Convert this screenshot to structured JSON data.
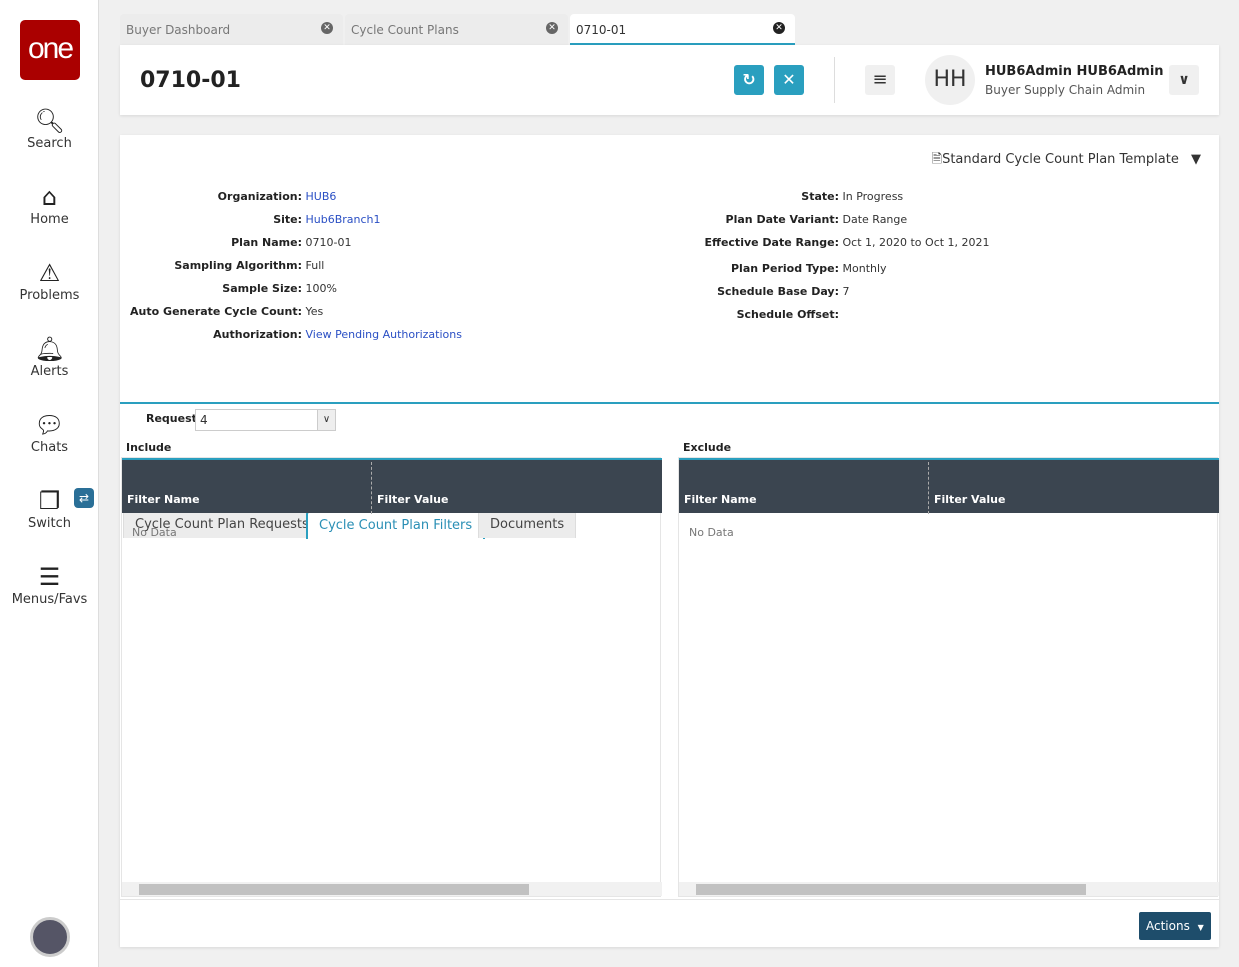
{
  "sidebar": {
    "logo": "one",
    "items": [
      {
        "label": "Search",
        "icon": "search-icon"
      },
      {
        "label": "Home",
        "icon": "home-icon"
      },
      {
        "label": "Problems",
        "icon": "warning-icon"
      },
      {
        "label": "Alerts",
        "icon": "bell-icon"
      },
      {
        "label": "Chats",
        "icon": "chat-icon"
      },
      {
        "label": "Switch",
        "icon": "switch-icon"
      },
      {
        "label": "Menus/Favs",
        "icon": "menu-icon"
      }
    ]
  },
  "tabs": [
    {
      "label": "Buyer Dashboard"
    },
    {
      "label": "Cycle Count Plans"
    },
    {
      "label": "0710-01"
    }
  ],
  "header": {
    "title": "0710-01",
    "user_initials": "HH",
    "user_name": "HUB6Admin HUB6Admin",
    "user_role": "Buyer Supply Chain Admin"
  },
  "template": "Standard Cycle Count Plan Template",
  "fields_left": [
    {
      "label": "Organization:",
      "value": "HUB6",
      "link": true
    },
    {
      "label": "Site:",
      "value": "Hub6Branch1",
      "link": true
    },
    {
      "label": "Plan Name:",
      "value": "0710-01"
    },
    {
      "label": "Sampling Algorithm:",
      "value": "Full"
    },
    {
      "label": "Sample Size:",
      "value": "100%"
    },
    {
      "label": "Auto Generate Cycle Count:",
      "value": "Yes"
    },
    {
      "label": "Authorization:",
      "value": "View Pending Authorizations",
      "link": true
    }
  ],
  "fields_right": [
    {
      "label": "State:",
      "value": "In Progress"
    },
    {
      "label": "Plan Date Variant:",
      "value": "Date Range"
    },
    {
      "label": "Effective Date Range:",
      "value": "Oct 1, 2020 to Oct 1, 2021"
    },
    {
      "label": "Plan Period Type:",
      "value": "Monthly"
    },
    {
      "label": "Schedule Base Day:",
      "value": "7"
    },
    {
      "label": "Schedule Offset:",
      "value": ""
    }
  ],
  "page_tabs": [
    {
      "label": "Cycle Count Plan Requests"
    },
    {
      "label": "Cycle Count Plan Filters"
    },
    {
      "label": "Documents"
    }
  ],
  "request": {
    "label": "Request:",
    "value": "4"
  },
  "include": {
    "title": "Include",
    "col1": "Filter Name",
    "col2": "Filter Value",
    "empty": "No Data"
  },
  "exclude": {
    "title": "Exclude",
    "col1": "Filter Name",
    "col2": "Filter Value",
    "empty": "No Data"
  },
  "actions_label": "Actions"
}
